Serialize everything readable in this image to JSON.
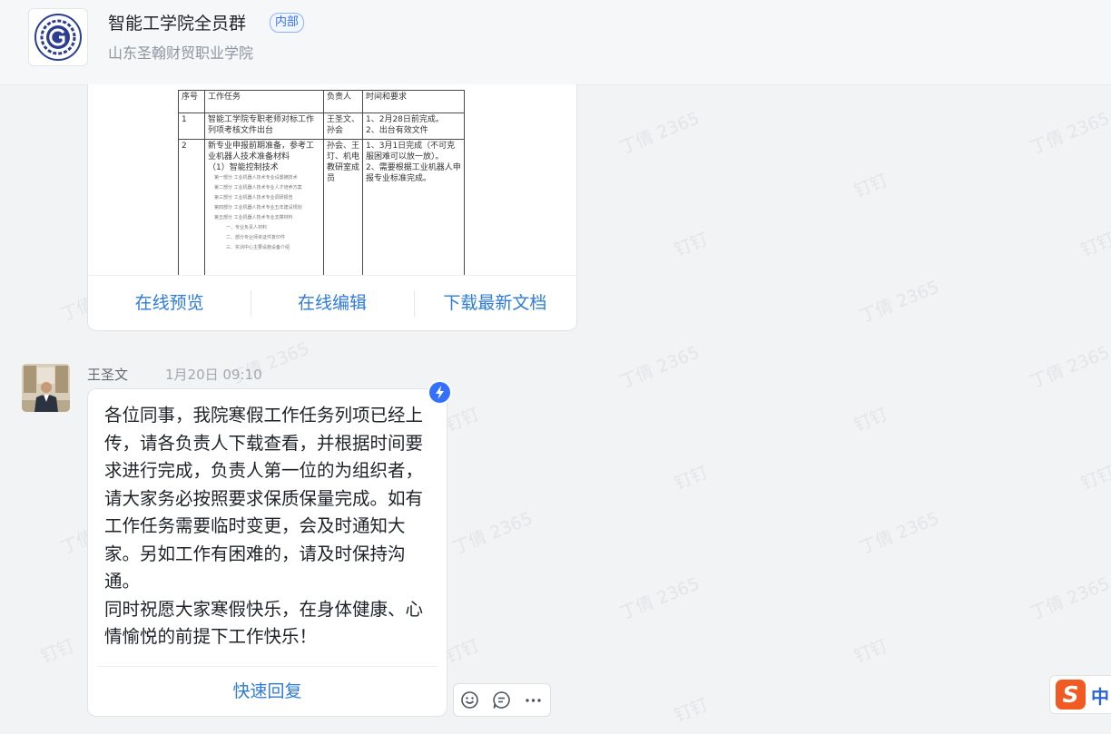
{
  "header": {
    "title": "智能工学院全员群",
    "badge": "内部",
    "subtitle": "山东圣翰财贸职业学院"
  },
  "watermark": {
    "name_text": "丁倩 2365",
    "app_text": "钉钉"
  },
  "document": {
    "table": {
      "headers": [
        "序号",
        "工作任务",
        "负责人",
        "时间和要求"
      ],
      "rows": [
        {
          "no": "1",
          "task": "智能工学院专职老师对标工作列项考核文件出台",
          "owner": "王圣文、孙会",
          "time": "1、2月28日前完成。\n2、出台有效文件"
        },
        {
          "no": "2",
          "task": "新专业申报前期准备，参考工业机器人技术准备材料\n（1）智能控制技术",
          "owner": "孙会、王玎、机电教研室成员",
          "time": "1、3月1日完成（不可克服困难可以放一放）。\n2、需要根据工业机器人申报专业标准完成。"
        }
      ],
      "sublines": [
        "第一部分 工业机器人技术专业设置摘技术",
        "第二部分 工业机器人技术专业人才培养方案",
        "第三部分 工业机器人技术专业调研报告",
        "第四部分 工业机器人技术专业五年建设规划",
        "第五部分 工业机器人技术专业支撑材料",
        "一、专业负责人材料",
        "二、部分专业师资证件复印件",
        "三、实训中心主要设施设备介绍"
      ]
    },
    "actions": {
      "preview": "在线预览",
      "edit": "在线编辑",
      "download": "下载最新文档"
    }
  },
  "message": {
    "sender": "王圣文",
    "timestamp": "1月20日 09:10",
    "text": "各位同事，我院寒假工作任务列项已经上传，请各负责人下载查看，并根据时间要求进行完成，负责人第一位的为组织者，请大家务必按照要求保质保量完成。如有工作任务需要临时变更，会及时通知大家。另如工作有困难的，请及时保持沟通。\n同时祝愿大家寒假快乐，在身体健康、心情愉悦的前提下工作快乐！",
    "quick_reply": "快速回复"
  },
  "toolbar": {
    "icons": [
      "emoji-icon",
      "reply-thread-icon",
      "more-icon"
    ]
  },
  "ime": {
    "mode": "中"
  },
  "colors": {
    "accent": "#2f7bd9",
    "brand_blue": "#3370ff",
    "background": "#f2f3f5",
    "ime_orange": "#f25a24"
  }
}
